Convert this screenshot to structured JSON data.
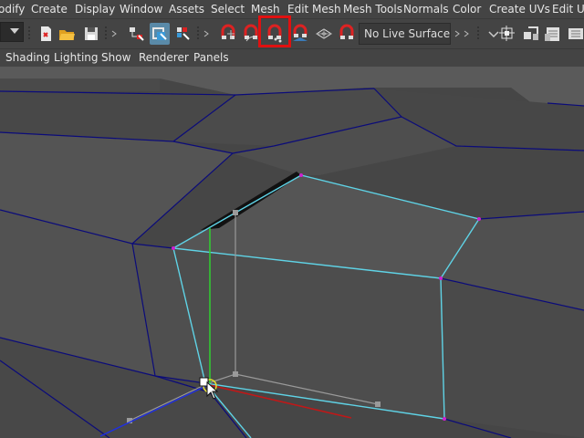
{
  "menubar": {
    "items": [
      "odify",
      "Create",
      "Display",
      "Window",
      "Assets",
      "Select",
      "Mesh",
      "Edit Mesh",
      "Mesh Tools",
      "Normals",
      "Color",
      "Create UVs",
      "Edit UV"
    ]
  },
  "toolbar": {
    "live_surface": "No Live Surface",
    "highlighted_tool": "target-weld-icon",
    "icons": [
      "select-by-hierarchy-icon",
      "select-by-object-icon",
      "select-by-component-icon",
      "snap-to-grid-icon",
      "snap-to-curve-icon",
      "target-weld-icon",
      "snap-to-view-plane-icon",
      "snap-to-live-icon",
      "make-live-icon",
      "construction-history-icon",
      "render-frame-icon",
      "render-settings-icon"
    ]
  },
  "panel_menu": {
    "items": [
      "Shading",
      "Lighting",
      "Show",
      "Renderer",
      "Panels"
    ]
  },
  "colors": {
    "ui_background": "#444444",
    "viewport_background": "#5a5a5a",
    "mesh_face": "#464646",
    "wireframe": "#0b0b7a",
    "selected_edges": "#5fd3e6",
    "selected_vertex": "#d020d0",
    "highlight_box": "#e01010",
    "manipulator_y": "#30d030",
    "manipulator_x": "#c01818",
    "manipulator_z": "#2030e0"
  }
}
